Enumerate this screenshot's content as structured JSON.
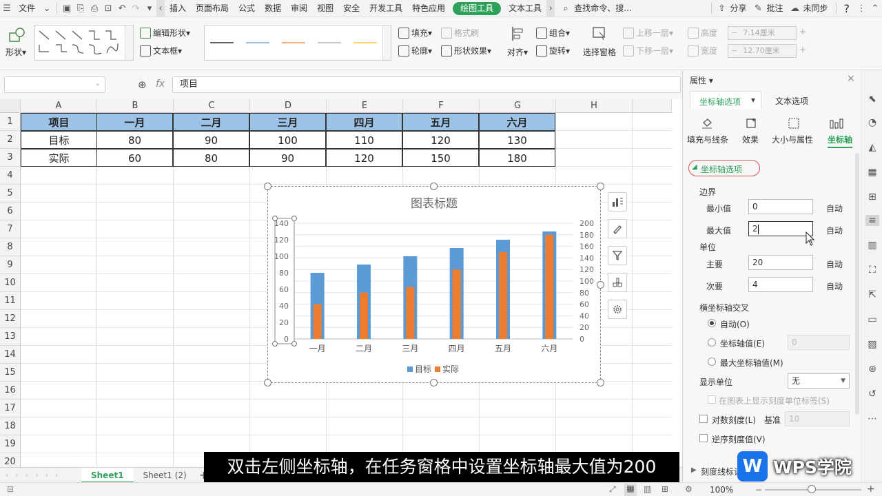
{
  "menubar": {
    "file_label": "文件",
    "tabs": [
      "插入",
      "页面布局",
      "公式",
      "数据",
      "审阅",
      "视图",
      "安全",
      "开发工具",
      "特色应用",
      "绘图工具",
      "文本工具"
    ],
    "active_tab": "绘图工具",
    "search_label": "查找命令、搜...",
    "share_label": "分享",
    "comment_label": "批注",
    "sync_label": "未同步",
    "help_icon": "?"
  },
  "ribbon": {
    "shape_label": "形状",
    "edit_shape_label": "编辑形状",
    "textbox_label": "文本框",
    "fill_label": "填充",
    "format_painter_label": "格式刷",
    "outline_label": "轮廓",
    "shape_effect_label": "形状效果",
    "align_label": "对齐",
    "group_label": "组合",
    "rotate_label": "旋转",
    "select_pane_label": "选择窗格",
    "bring_forward_label": "上移一层",
    "send_backward_label": "下移一层",
    "height_label": "高度",
    "width_label": "宽度",
    "height_value": "7.14厘米",
    "width_value": "12.70厘米",
    "line_colors": [
      "#333333",
      "#5b9bd5",
      "#ed7d31",
      "#a5a5a5",
      "#ffc000"
    ]
  },
  "formula": {
    "fx_label": "fx",
    "content": "项目"
  },
  "sheet": {
    "columns": [
      "A",
      "B",
      "C",
      "D",
      "E",
      "F",
      "G",
      "H"
    ],
    "rows": [
      "1",
      "2",
      "3",
      "4",
      "5",
      "6",
      "7",
      "8",
      "9",
      "10",
      "11",
      "12",
      "13",
      "14",
      "15",
      "16",
      "17",
      "18",
      "19",
      "20"
    ],
    "table": [
      [
        "项目",
        "一月",
        "二月",
        "三月",
        "四月",
        "五月",
        "六月"
      ],
      [
        "目标",
        "80",
        "90",
        "100",
        "110",
        "120",
        "130"
      ],
      [
        "实际",
        "60",
        "80",
        "90",
        "120",
        "150",
        "180"
      ]
    ],
    "header_color": "#9dc3e6"
  },
  "chart_data": {
    "type": "bar",
    "title": "图表标题",
    "categories": [
      "一月",
      "二月",
      "三月",
      "四月",
      "五月",
      "六月"
    ],
    "series": [
      {
        "name": "目标",
        "values": [
          80,
          90,
          100,
          110,
          120,
          130
        ],
        "color": "#5b9bd5",
        "axis": "primary"
      },
      {
        "name": "实际",
        "values": [
          60,
          80,
          90,
          120,
          150,
          180
        ],
        "color": "#ed7d31",
        "axis": "secondary"
      }
    ],
    "y_left_ticks": [
      "0",
      "20",
      "40",
      "60",
      "80",
      "100",
      "120",
      "140"
    ],
    "y_right_ticks": [
      "0",
      "20",
      "40",
      "60",
      "80",
      "100",
      "120",
      "140",
      "160",
      "180",
      "200"
    ],
    "ylim_left": [
      0,
      140
    ],
    "ylim_right": [
      0,
      200
    ],
    "legend_position": "bottom",
    "grid": true
  },
  "chart_tools": [
    "chart-elements-icon",
    "chart-style-icon",
    "chart-filter-icon",
    "chart-layout-icon",
    "chart-settings-icon"
  ],
  "tabs": {
    "sheets": [
      "Sheet1",
      "Sheet1 (2)"
    ],
    "active": "Sheet1",
    "add_label": "+"
  },
  "status": {
    "zoom": "100%"
  },
  "subtitle": "双击左侧坐标轴，在任务窗格中设置坐标轴最大值为200",
  "logo_text": "WPS学院",
  "logo_letter": "W",
  "taskpane": {
    "title": "属性",
    "tab_axis": "坐标轴选项",
    "tab_text": "文本选项",
    "subtabs": [
      "填充与线条",
      "效果",
      "大小与属性",
      "坐标轴"
    ],
    "section_axis": "坐标轴选项",
    "bounds_label": "边界",
    "min_label": "最小值",
    "min_value": "0",
    "max_label": "最大值",
    "max_value": "2",
    "auto_label": "自动",
    "units_label": "单位",
    "major_label": "主要",
    "major_value": "20",
    "minor_label": "次要",
    "minor_value": "4",
    "cross_label": "横坐标轴交叉",
    "cross_auto": "自动(O)",
    "cross_value": "坐标轴值(E)",
    "cross_value_input": "0",
    "cross_max": "最大坐标轴值(M)",
    "display_units_label": "显示单位",
    "display_units_value": "无",
    "show_units_label": "在图表上显示刻度单位标签(S)",
    "log_label": "对数刻度(L)",
    "base_label": "基准",
    "base_value": "10",
    "reverse_label": "逆序刻度值(V)",
    "tick_label": "刻度线标记"
  }
}
